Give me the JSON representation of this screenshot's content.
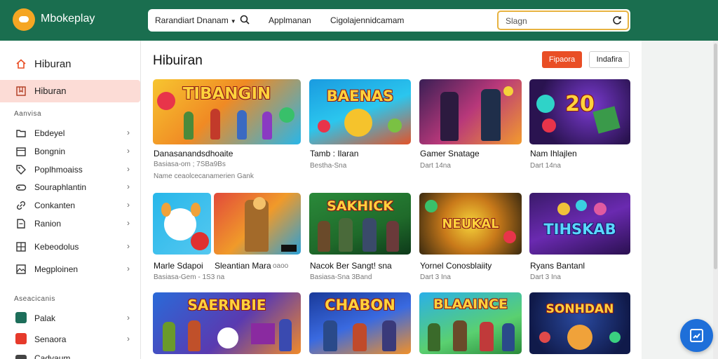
{
  "header": {
    "brand": "Mbokeplay",
    "filter_label": "Rarandiart Dnanam",
    "link1": "Applmanan",
    "link2": "Cigolajennidcamam",
    "signin_placeholder": "Slagn"
  },
  "sidebar": {
    "home": "Hiburan",
    "active": "Hiburan",
    "section1": "Aanvisa",
    "items": [
      "Ebdeyel",
      "Bongnin",
      "Poplhmoaiss",
      "Souraphlantin",
      "Conkanten",
      "Ranion",
      "Kebeodolus",
      "Megploinen"
    ],
    "section2": "Aseacicanis",
    "apps": [
      "Palak",
      "Senaora",
      "Cadvaum"
    ]
  },
  "content": {
    "title": "Hibuiran",
    "btn_primary": "Fipaora",
    "btn_secondary": "Indafira"
  },
  "cards": [
    {
      "thumb": "TIBANGIN",
      "title": "Danasanandsdhoaite",
      "meta": "Basiasa-om ; 7SBa9Bs",
      "extra": "Name ceaolcecanamerien Gank"
    },
    {
      "thumb": "BAENAS",
      "title": "Tamb : Ilaran",
      "meta": "Bestha-Sna"
    },
    {
      "thumb": "",
      "title": "Gamer Snatage",
      "meta": "Dart 14na"
    },
    {
      "thumb": "20",
      "title": "Nam Ihlajlen",
      "meta": "Dart 14na"
    },
    {
      "thumb": "",
      "title": "Marle Sdapoi",
      "meta": "Basiasa-Gem - 1S3 na"
    },
    {
      "thumb": "",
      "title": "Sleantian Mara",
      "meta": "",
      "extra": "oaoo"
    },
    {
      "thumb": "SAKHICK",
      "title": "Nacok Ber Sangt! sna",
      "meta": "Basiasa-Sna 3Band"
    },
    {
      "thumb": "NEUKAL",
      "title": "Yornel Conosblaiity",
      "meta": "Dart 3 Ina"
    },
    {
      "thumb": "TIHSKAB",
      "title": "Ryans Bantanl",
      "meta": "Dart 3 Ina"
    },
    {
      "thumb": "SAERNBIE",
      "title": "",
      "meta": ""
    },
    {
      "thumb": "CHABON",
      "title": "",
      "meta": ""
    },
    {
      "thumb": "BLAAINCE",
      "title": "",
      "meta": ""
    },
    {
      "thumb": "SONHDAN",
      "title": "",
      "meta": ""
    }
  ],
  "colors": {
    "header_bg": "#1a6e4f",
    "accent": "#e94e25",
    "active_bg": "#fcdcd6",
    "fab": "#1e6fd9"
  }
}
